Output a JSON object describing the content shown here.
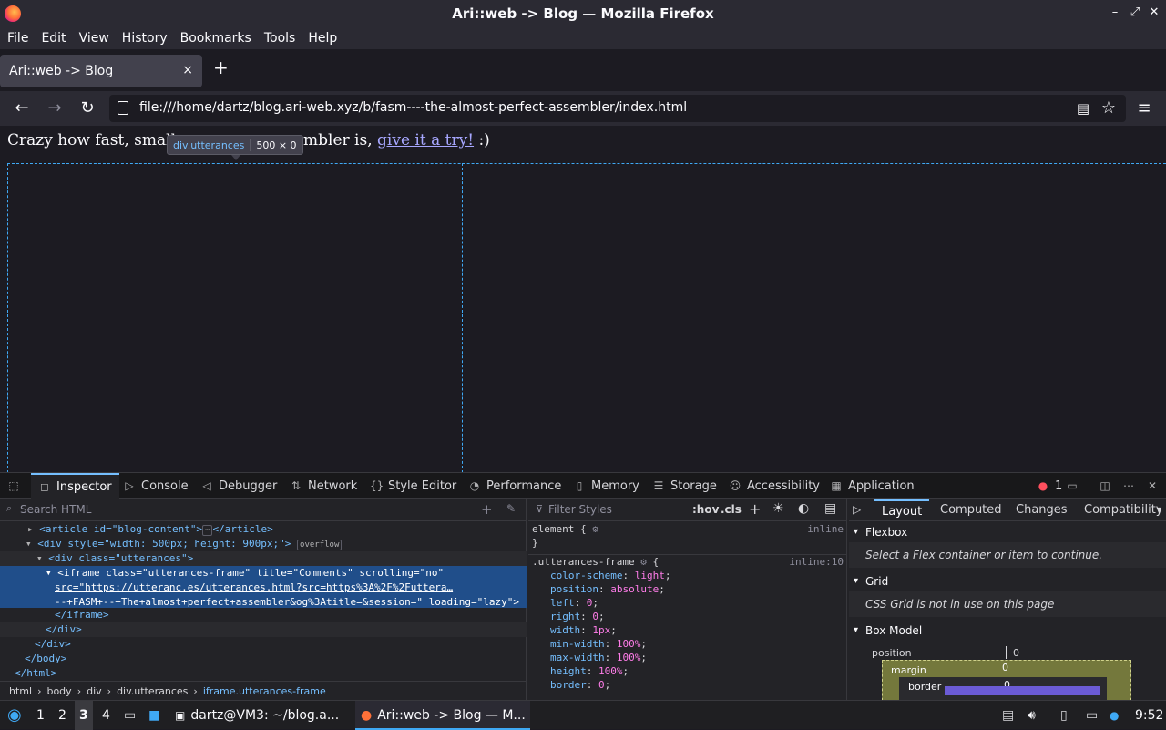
{
  "window": {
    "title": "Ari::web -> Blog — Mozilla Firefox"
  },
  "menubar": [
    "File",
    "Edit",
    "View",
    "History",
    "Bookmarks",
    "Tools",
    "Help"
  ],
  "tab": {
    "title": "Ari::web -> Blog",
    "close": "×"
  },
  "newtab": "+",
  "nav": {
    "url": "file:///home/dartz/blog.ari-web.xyz/b/fasm----the-almost-perfect-assembler/index.html"
  },
  "content": {
    "para_text": "Crazy how fast, small",
    "para_text2": "mbler is,",
    "para_link": "give it a try!",
    "para_end": ":)"
  },
  "tooltip": {
    "selector": "div.utterances",
    "size": "500 × 0"
  },
  "devtools": {
    "tabs": [
      "Inspector",
      "Console",
      "Debugger",
      "Network",
      "Style Editor",
      "Performance",
      "Memory",
      "Storage",
      "Accessibility",
      "Application"
    ],
    "error_count": "1",
    "search_placeholder": "Search HTML",
    "markup": {
      "l1": "<article id=\"blog-content\">",
      "l1b": "</article>",
      "l2": "<div style=\"width: 500px; height: 900px;\">",
      "l2badge": "overflow",
      "l3": "<div class=\"utterances\">",
      "l4a": "<iframe class=\"utterances-frame\" title=\"Comments\" scrolling=\"no\"",
      "l4b": "src=\"https://utteranc.es/utterances.html?src=https%3A%2F%2Futtera…",
      "l4c": "--+FASM+--+The+almost+perfect+assembler&og%3Atitle=&session=\" loading=\"lazy\">",
      "l5": "</iframe>",
      "l6": "</div>",
      "l7": "</div>",
      "l8": "</body>",
      "l9": "</html>"
    },
    "breadcrumbs": [
      "html",
      "body",
      "div",
      "div.utterances",
      "iframe.utterances-frame"
    ],
    "rules": {
      "filter_placeholder": "Filter Styles",
      "hov": ":hov",
      "cls": ".cls",
      "element": "element {",
      "element_close": "}",
      "element_src": "inline",
      "selector": ".utterances-frame",
      "selector_src": "inline:10",
      "props": [
        [
          "color-scheme",
          "light"
        ],
        [
          "position",
          "absolute"
        ],
        [
          "left",
          "0"
        ],
        [
          "right",
          "0"
        ],
        [
          "width",
          "1px"
        ],
        [
          "min-width",
          "100%"
        ],
        [
          "max-width",
          "100%"
        ],
        [
          "height",
          "100%"
        ],
        [
          "border",
          "0"
        ]
      ]
    },
    "layout": {
      "tabs": [
        "Layout",
        "Computed",
        "Changes",
        "Compatibility"
      ],
      "flexbox": "Flexbox",
      "flexbox_msg": "Select a Flex container or item to continue.",
      "grid": "Grid",
      "grid_msg": "CSS Grid is not in use on this page",
      "boxmodel": "Box Model",
      "position_label": "position",
      "position_val": "0",
      "margin_label": "margin",
      "margin_val": "0",
      "border_label": "border",
      "border_val": "0"
    }
  },
  "taskbar": {
    "workspaces": [
      "1",
      "2",
      "3",
      "4"
    ],
    "terminal": "dartz@VM3: ~/blog.a...",
    "firefox": "Ari::web -> Blog — M...",
    "clock": "9:52"
  }
}
